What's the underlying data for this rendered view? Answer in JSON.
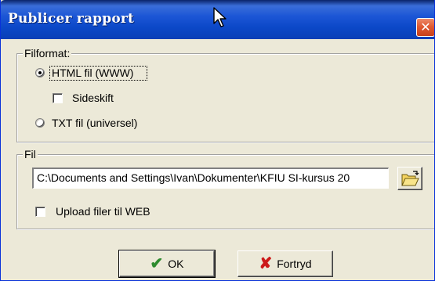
{
  "window": {
    "title": "Publicer rapport",
    "close_label": "✕"
  },
  "format_group": {
    "legend": "Filformat:",
    "options": [
      {
        "label": "HTML fil (WWW)",
        "selected": true
      },
      {
        "label": "TXT fil (universel)",
        "selected": false
      }
    ],
    "page_break": {
      "label": "Sideskift",
      "checked": false
    }
  },
  "file_group": {
    "legend": "Fil",
    "path_value": "C:\\Documents and Settings\\Ivan\\Dokumenter\\KFIU SI-kursus 20",
    "upload": {
      "label": "Upload filer til WEB",
      "checked": false
    }
  },
  "buttons": {
    "ok_label": "OK",
    "cancel_label": "Fortryd"
  },
  "icons": {
    "close": "close-icon",
    "browse": "folder-open-icon",
    "ok": "check-icon",
    "cancel": "x-icon",
    "cursor": "mouse-pointer-icon"
  },
  "colors": {
    "titlebar": "#0b48c8",
    "dialog_bg": "#ece9d8",
    "close_button": "#e05a32",
    "ok_check": "#2e8b2e",
    "cancel_x": "#cc1a1a"
  }
}
